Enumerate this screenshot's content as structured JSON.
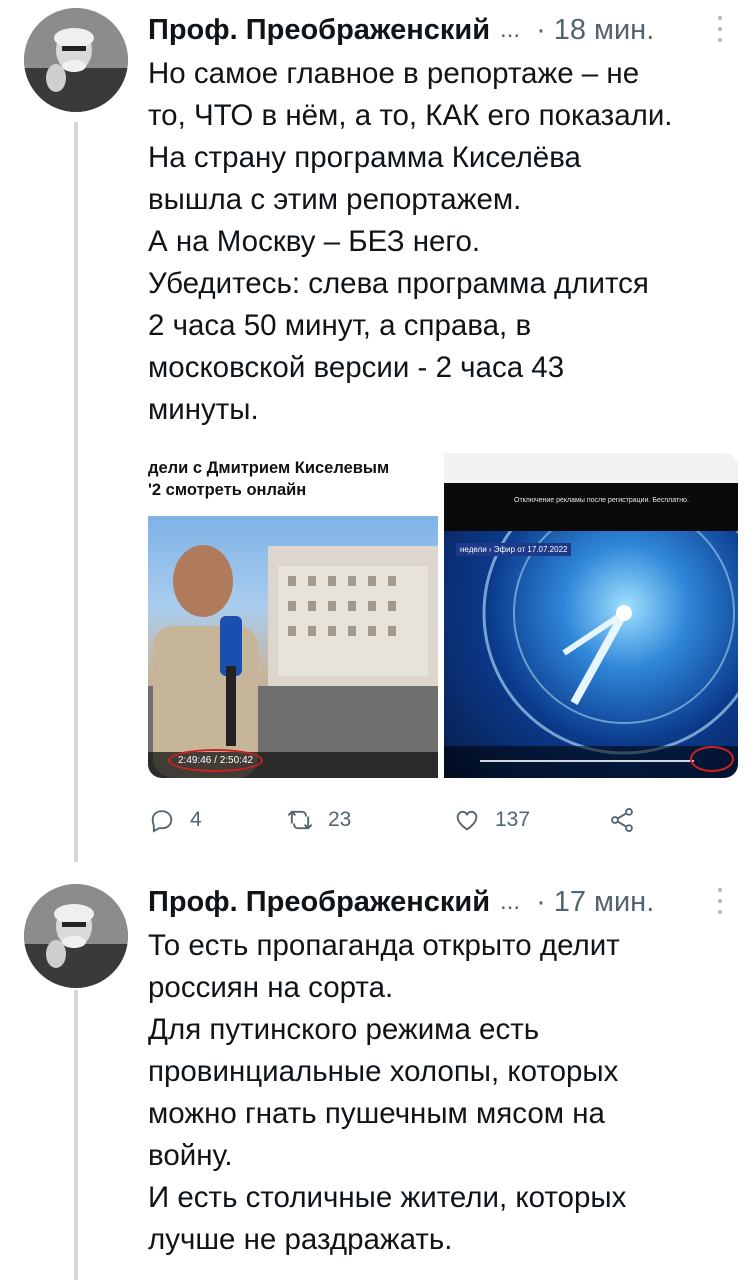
{
  "tweets": [
    {
      "author": "Проф. Преображенский",
      "ellipsis": "...",
      "separator": "·",
      "time": "18 мин.",
      "lines": [
        "Но самое главное в репортаже – не",
        "то, ЧТО в нём, а то, КАК его показали.",
        "На страну программа Киселёва",
        "вышла с этим репортажем.",
        "А на Москву – БЕЗ него.",
        "Убедитесь: слева программа длится",
        "2 часа 50 минут, а справа, в",
        "московской версии - 2 часа 43",
        "минуты."
      ],
      "media": {
        "left": {
          "title_line1": "дели с Дмитрием Киселевым",
          "title_line2": "'2 смотреть онлайн",
          "timecode": "2:49:46 / 2:50:42"
        },
        "right": {
          "banner": "Отключение рекламы после регистрации. Бесплатно.",
          "tag": "недели › Эфир от 17.07.2022"
        }
      },
      "actions": {
        "reply_count": "4",
        "retweet_count": "23",
        "like_count": "137"
      }
    },
    {
      "author": "Проф. Преображенский",
      "ellipsis": "...",
      "separator": "·",
      "time": "17 мин.",
      "lines": [
        "То есть пропаганда открыто делит",
        "россиян на сорта.",
        "Для путинского режима есть",
        "провинциальные холопы, которых",
        "можно гнать пушечным мясом на",
        "войну.",
        "И есть столичные жители, которых",
        "лучше не раздражать."
      ]
    }
  ],
  "colors": {
    "text": "#0f1419",
    "secondary": "#536471",
    "thread_line": "#cfd9de",
    "annotation_red": "#d02020"
  },
  "icons": [
    "reply-icon",
    "retweet-icon",
    "like-icon",
    "share-icon",
    "more-icon"
  ]
}
